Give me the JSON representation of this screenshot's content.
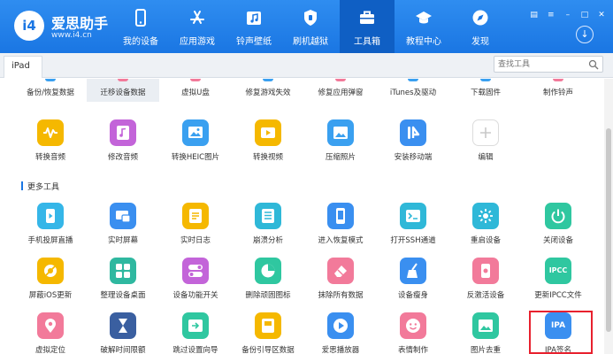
{
  "header": {
    "logo_mark": "i4",
    "app_name": "爱思助手",
    "url": "www.i4.cn",
    "nav": [
      {
        "label": "我的设备",
        "icon": "phone-icon"
      },
      {
        "label": "应用游戏",
        "icon": "appstore-icon"
      },
      {
        "label": "铃声壁纸",
        "icon": "music-icon"
      },
      {
        "label": "刷机越狱",
        "icon": "shield-icon"
      },
      {
        "label": "工具箱",
        "icon": "toolbox-icon",
        "active": true
      },
      {
        "label": "教程中心",
        "icon": "graduation-cap-icon"
      },
      {
        "label": "发现",
        "icon": "compass-icon"
      }
    ],
    "download_icon": "download-circle-icon"
  },
  "tabbar": {
    "tab_label": "iPad",
    "search_placeholder": "查找工具"
  },
  "top_row_cut": [
    {
      "label": "备份/恢复数据",
      "color": "#3aa0f0"
    },
    {
      "label": "迁移设备数据",
      "color": "#f27a9a",
      "selected": true
    },
    {
      "label": "虚拟U盘",
      "color": "#f27a9a"
    },
    {
      "label": "修复游戏失效",
      "color": "#3aa0f0"
    },
    {
      "label": "修复应用弹窗",
      "color": "#f27a9a"
    },
    {
      "label": "iTunes及驱动",
      "color": "#3aa0f0"
    },
    {
      "label": "下载固件",
      "color": "#3aa0f0"
    },
    {
      "label": "制作铃声",
      "color": "#f27a9a"
    }
  ],
  "row1": [
    {
      "label": "转换音频",
      "color": "#f5b800",
      "icon": "waveform-icon"
    },
    {
      "label": "修改音频",
      "color": "#c364d9",
      "icon": "music-file-icon"
    },
    {
      "label": "转换HEIC图片",
      "color": "#3aa0f0",
      "icon": "image-convert-icon"
    },
    {
      "label": "转换视频",
      "color": "#f5b800",
      "icon": "video-icon"
    },
    {
      "label": "压缩照片",
      "color": "#3aa0f0",
      "icon": "photo-icon"
    },
    {
      "label": "安装移动端",
      "color": "#3a8ff0",
      "icon": "i4-logo-icon"
    },
    {
      "label": "编辑",
      "color": "#ffffff",
      "icon": "plus-icon"
    }
  ],
  "section_title": "更多工具",
  "row2": [
    {
      "label": "手机投屏直播",
      "color": "#35b6e8",
      "icon": "screen-mirror-icon"
    },
    {
      "label": "实时屏幕",
      "color": "#3a8ff0",
      "icon": "realtime-screen-icon"
    },
    {
      "label": "实时日志",
      "color": "#f5b800",
      "icon": "log-icon"
    },
    {
      "label": "崩溃分析",
      "color": "#2fb8d8",
      "icon": "crash-analysis-icon"
    },
    {
      "label": "进入恢复模式",
      "color": "#3a8ff0",
      "icon": "recovery-mode-icon"
    },
    {
      "label": "打开SSH通道",
      "color": "#2fb8d8",
      "icon": "terminal-icon"
    },
    {
      "label": "重启设备",
      "color": "#2fb8d8",
      "icon": "restart-icon"
    },
    {
      "label": "关闭设备",
      "color": "#2fc7a0",
      "icon": "power-icon"
    }
  ],
  "row3": [
    {
      "label": "屏蔽iOS更新",
      "color": "#f5b800",
      "icon": "gear-block-icon"
    },
    {
      "label": "整理设备桌面",
      "color": "#2fb8a0",
      "icon": "grid-icon"
    },
    {
      "label": "设备功能开关",
      "color": "#c364d9",
      "icon": "toggle-icon"
    },
    {
      "label": "删除顽固图标",
      "color": "#2fc7a0",
      "icon": "pie-icon"
    },
    {
      "label": "抹除所有数据",
      "color": "#f27a9a",
      "icon": "eraser-icon"
    },
    {
      "label": "设备瘦身",
      "color": "#3a8ff0",
      "icon": "broom-icon"
    },
    {
      "label": "反激活设备",
      "color": "#f27a9a",
      "icon": "deactivate-icon"
    },
    {
      "label": "更新IPCC文件",
      "color": "#2fc7a0",
      "icon": "ipcc-icon",
      "text": "IPCC"
    }
  ],
  "row4": [
    {
      "label": "虚拟定位",
      "color": "#f27a9a",
      "icon": "location-pin-icon"
    },
    {
      "label": "破解时间限额",
      "color": "#3a5fa0",
      "icon": "hourglass-icon"
    },
    {
      "label": "跳过设置向导",
      "color": "#2fc7a0",
      "icon": "skip-setup-icon"
    },
    {
      "label": "备份引导区数据",
      "color": "#f5b800",
      "icon": "backup-boot-icon"
    },
    {
      "label": "爱思播放器",
      "color": "#3a8ff0",
      "icon": "play-icon"
    },
    {
      "label": "表情制作",
      "color": "#f27a9a",
      "icon": "emoji-icon"
    },
    {
      "label": "图片去重",
      "color": "#2fc7a0",
      "icon": "image-dedupe-icon"
    },
    {
      "label": "IPA签名",
      "color": "#3a8ff0",
      "icon": "ipa-icon",
      "text": "IPA"
    }
  ]
}
